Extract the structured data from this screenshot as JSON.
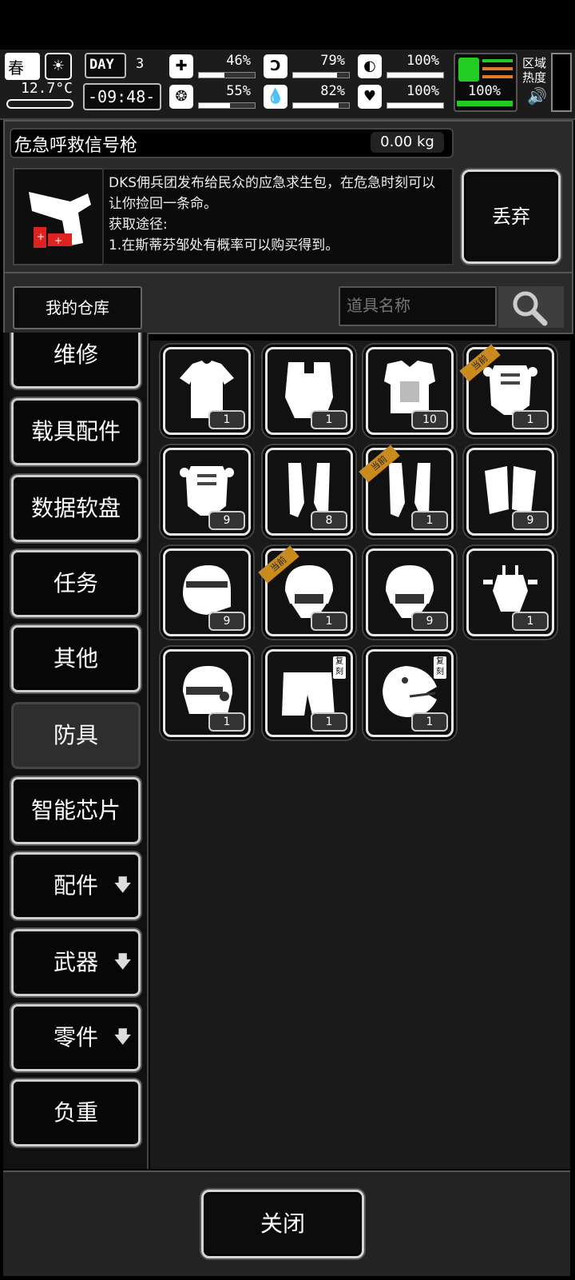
{
  "hud": {
    "season": "春",
    "temperature": "12.7°C",
    "day_label": "DAY",
    "day_number": "3",
    "clock": "-09:48-",
    "stats": [
      {
        "icon": "medkit-icon",
        "value": "46%",
        "fraction": 0.46
      },
      {
        "icon": "stomach-icon",
        "value": "79%",
        "fraction": 0.79
      },
      {
        "icon": "armor-icon",
        "value": "100%",
        "fraction": 1.0
      },
      {
        "icon": "brain-icon",
        "value": "55%",
        "fraction": 0.55
      },
      {
        "icon": "water-drop-icon",
        "value": "82%",
        "fraction": 0.82
      },
      {
        "icon": "heart-icon",
        "value": "100%",
        "fraction": 1.0
      }
    ],
    "stamina_value": "100%",
    "zone_heat_label": "区域\n热度",
    "colors": {
      "stamina_green": "#22cc22",
      "stamina_orange": "#e07b2a"
    }
  },
  "item": {
    "name": "危急呼救信号枪",
    "weight": "0.00 kg",
    "description": "DKS佣兵团发布给民众的应急求生包，在危急时刻可以让你捡回一条命。\n获取途径:\n1.在斯蒂芬邹处有概率可以购买得到。",
    "discard_label": "丢弃"
  },
  "search": {
    "warehouse_label": "我的仓库",
    "placeholder": "道具名称"
  },
  "categories": [
    {
      "label": "维修"
    },
    {
      "label": "载具配件"
    },
    {
      "label": "数据软盘"
    },
    {
      "label": "任务"
    },
    {
      "label": "其他"
    },
    {
      "label": "防具",
      "active": true
    },
    {
      "label": "智能芯片"
    },
    {
      "label": "配件",
      "arrow": "🡇"
    },
    {
      "label": "武器",
      "arrow": "🡇"
    },
    {
      "label": "零件",
      "arrow": "🡇"
    },
    {
      "label": "负重"
    }
  ],
  "items": [
    {
      "icon": "tshirt-icon",
      "count": "1"
    },
    {
      "icon": "vest-icon",
      "count": "1"
    },
    {
      "icon": "body-armor-icon",
      "count": "10"
    },
    {
      "icon": "plate-carrier-icon",
      "count": "1",
      "tag": "当前"
    },
    {
      "icon": "plate-carrier-icon",
      "count": "9"
    },
    {
      "icon": "leg-guards-icon",
      "count": "8"
    },
    {
      "icon": "leg-guards-icon",
      "count": "1",
      "tag": "当前"
    },
    {
      "icon": "knee-pads-icon",
      "count": "9"
    },
    {
      "icon": "helmet-icon",
      "count": "9"
    },
    {
      "icon": "tactical-helmet-icon",
      "count": "1",
      "tag": "当前"
    },
    {
      "icon": "tactical-helmet-icon",
      "count": "9"
    },
    {
      "icon": "exo-armor-icon",
      "count": "1"
    },
    {
      "icon": "robot-helmet-icon",
      "count": "1"
    },
    {
      "icon": "shorts-icon",
      "count": "1",
      "copy_tag": "复刻"
    },
    {
      "icon": "dinosaur-head-icon",
      "count": "1",
      "copy_tag": "复刻"
    }
  ],
  "close_label": "关闭"
}
